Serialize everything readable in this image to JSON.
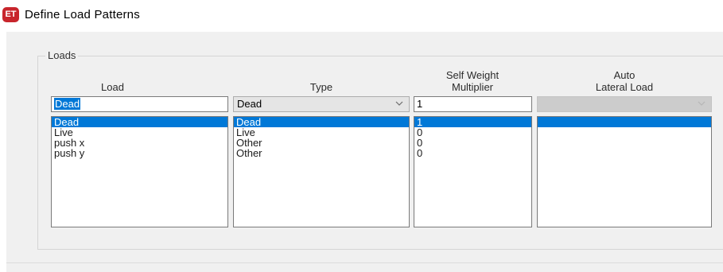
{
  "window": {
    "title": "Define Load Patterns",
    "app_icon_text": "ET",
    "app_icon_color": "#c8252c"
  },
  "group": {
    "title": "Loads"
  },
  "columns": {
    "load": {
      "header": "Load"
    },
    "type": {
      "header": "Type"
    },
    "self_weight": {
      "header_line1": "Self Weight",
      "header_line2": "Multiplier"
    },
    "auto_lateral": {
      "header_line1": "Auto",
      "header_line2": "Lateral Load"
    }
  },
  "editors": {
    "load_value": "Dead",
    "type_value": "Dead",
    "self_weight_value": "1",
    "auto_lateral_value": ""
  },
  "rows": [
    {
      "load": "Dead",
      "type": "Dead",
      "self_weight": "1",
      "auto_lateral": "",
      "selected": true
    },
    {
      "load": "Live",
      "type": "Live",
      "self_weight": "0",
      "auto_lateral": ""
    },
    {
      "load": "push x",
      "type": "Other",
      "self_weight": "0",
      "auto_lateral": ""
    },
    {
      "load": "push y",
      "type": "Other",
      "self_weight": "0",
      "auto_lateral": ""
    }
  ],
  "colors": {
    "selection": "#0078d7",
    "dialog_bg": "#f0f0f0"
  }
}
